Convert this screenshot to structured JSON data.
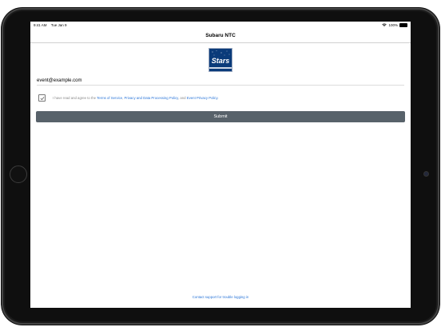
{
  "status_bar": {
    "time": "9:41 AM",
    "date": "Tue Jan 9",
    "battery": "100%"
  },
  "nav": {
    "title": "Subaru NTC"
  },
  "logo": {
    "text": "Stars"
  },
  "form": {
    "email_value": "event@example.com",
    "agreement": {
      "checked": true,
      "prefix": "I have read and agree to the ",
      "terms_link": "Terms of Service",
      "sep1": ", ",
      "privacy_link": "Privacy and Data Processing Policy",
      "sep2": ", and ",
      "event_link": "Event Privacy Policy",
      "suffix": "."
    },
    "submit_label": "Submit"
  },
  "support": {
    "label": "Contact support for trouble logging in"
  },
  "colors": {
    "accent_link": "#2a75d8",
    "button_bg": "#58626a",
    "logo_bg": "#0a3b7a"
  },
  "icons": [
    "wifi-icon",
    "battery-icon",
    "checkmark-icon",
    "home-button-icon",
    "camera-icon"
  ]
}
